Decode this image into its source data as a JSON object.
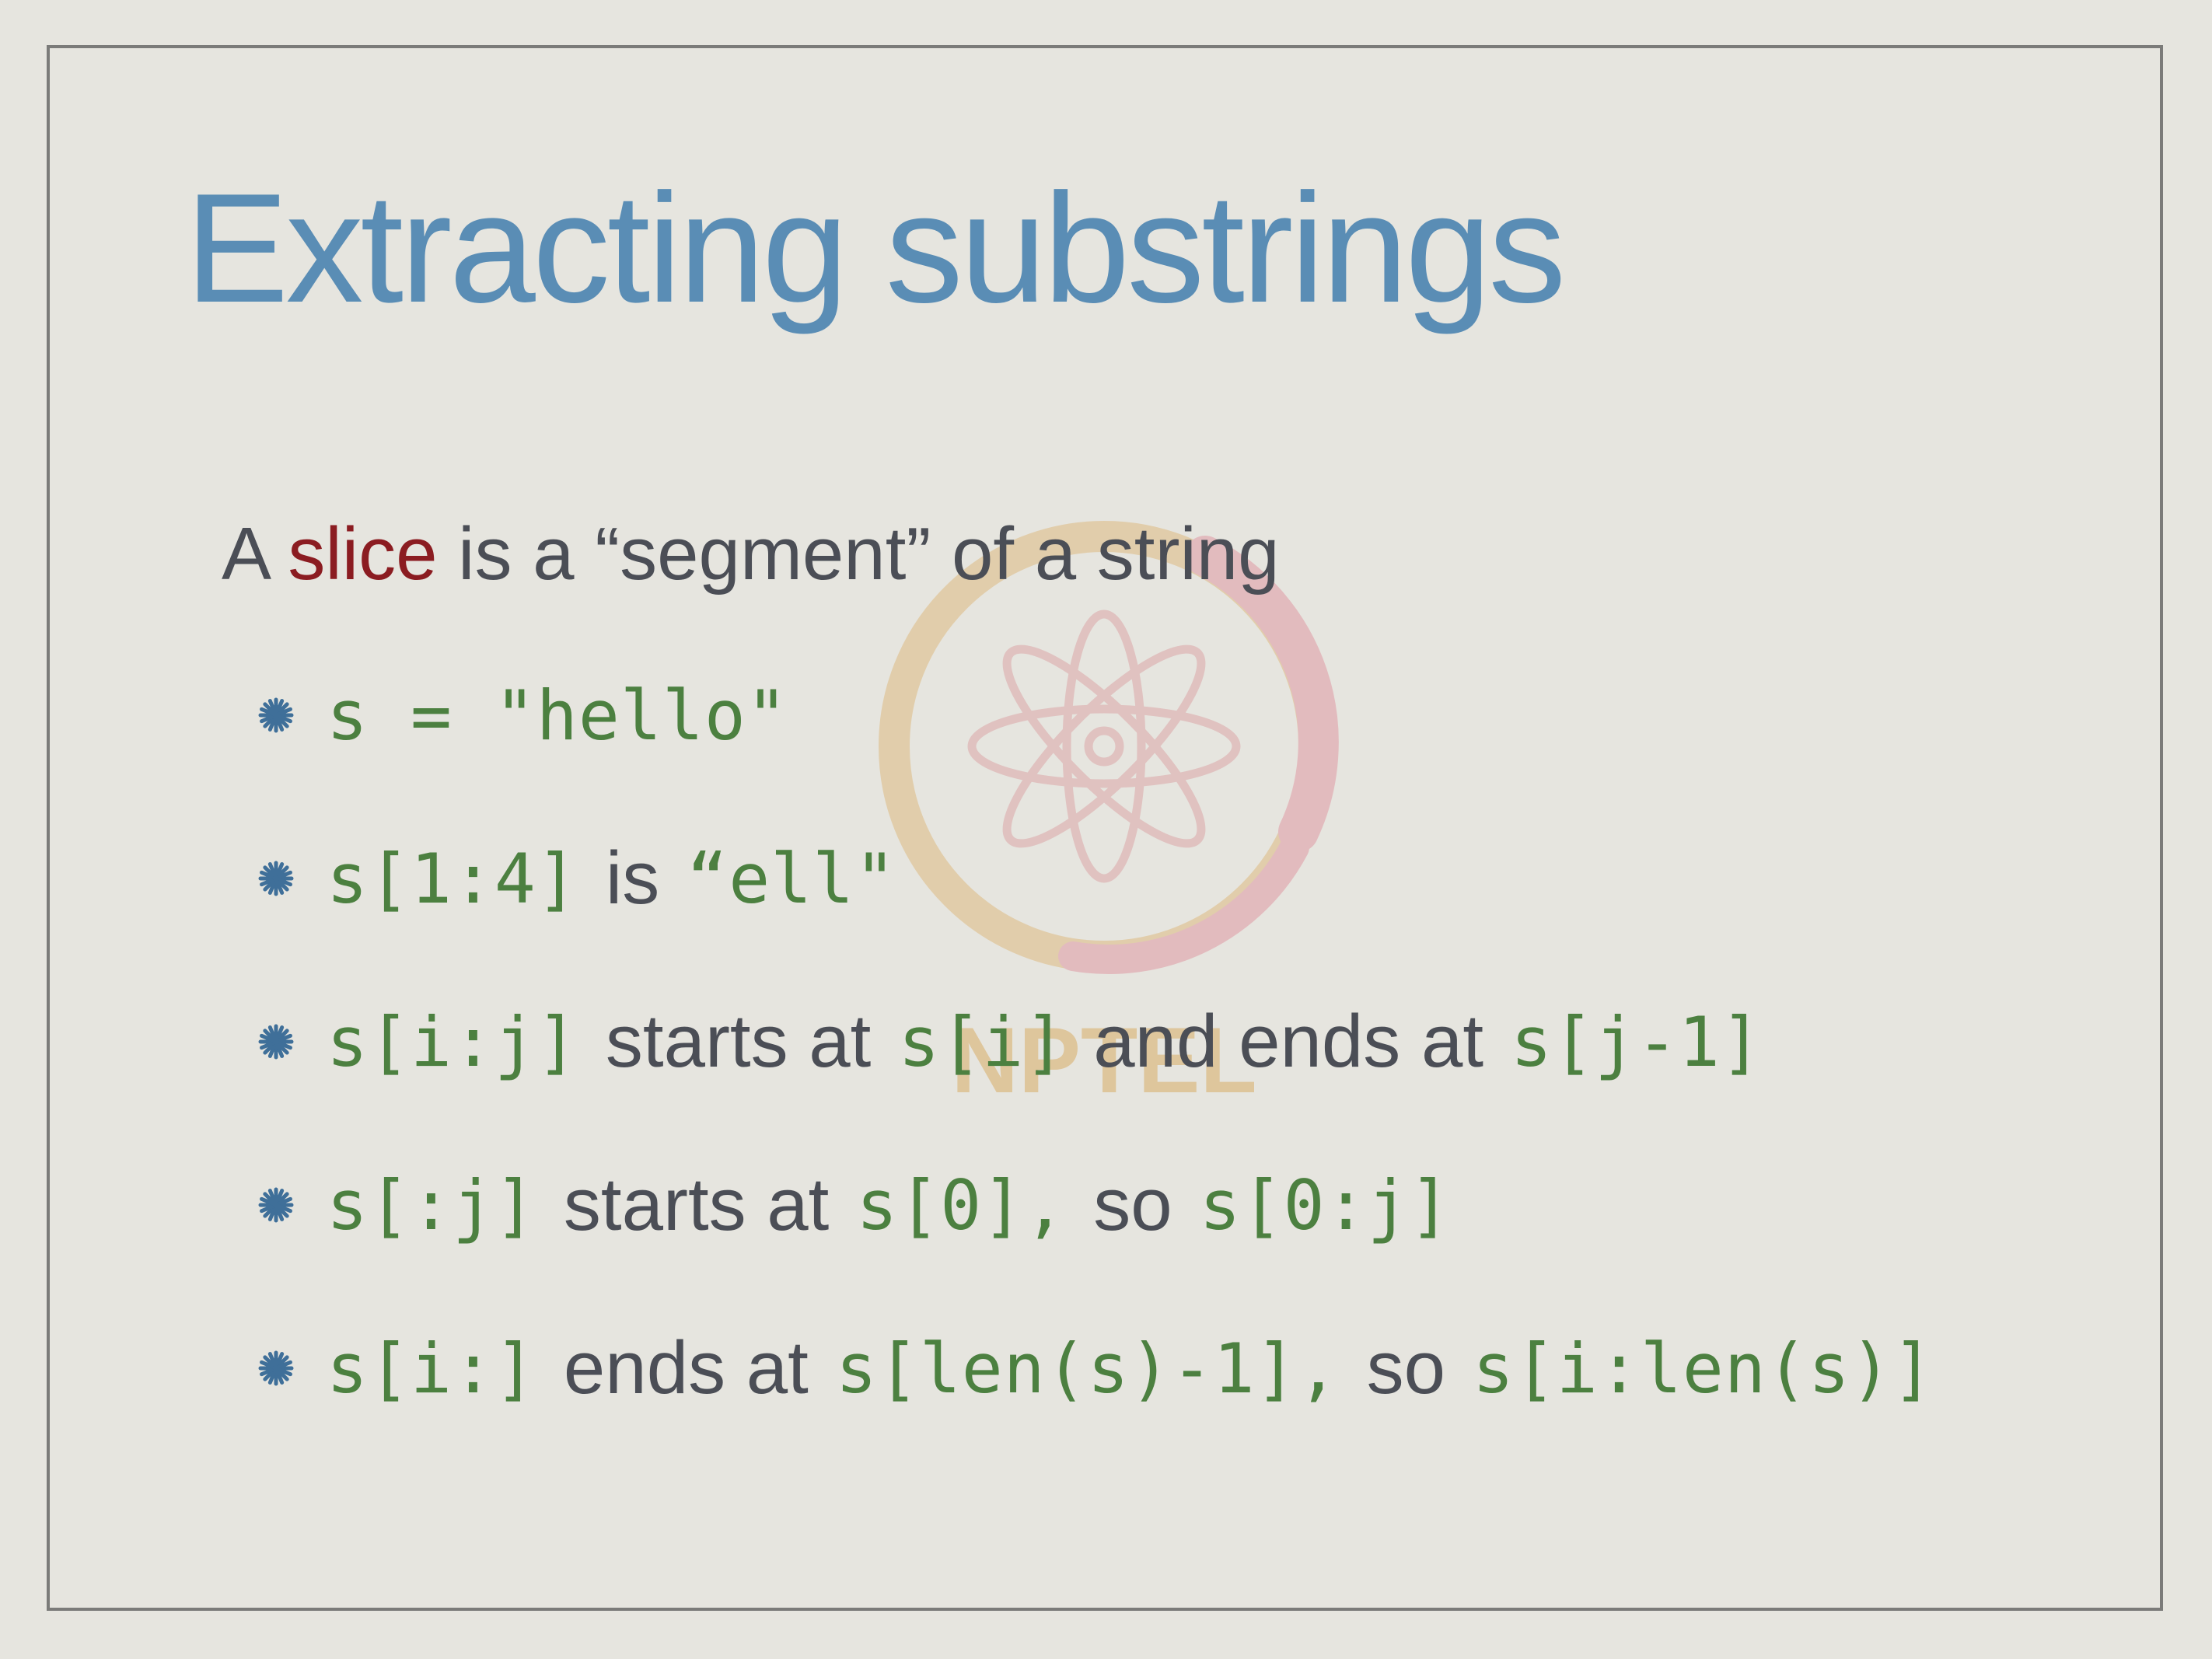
{
  "slide": {
    "title": "Extracting substrings",
    "intro": {
      "before": "A ",
      "highlight": "slice",
      "after": " is a “segment” of a string"
    },
    "bullets": [
      {
        "parts": [
          {
            "type": "code",
            "text": "s = \"hello\""
          }
        ]
      },
      {
        "parts": [
          {
            "type": "code",
            "text": "s[1:4]"
          },
          {
            "type": "text",
            "text": "is"
          },
          {
            "type": "code",
            "text": "“ell\""
          }
        ]
      },
      {
        "parts": [
          {
            "type": "code",
            "text": "s[i:j]"
          },
          {
            "type": "text",
            "text": "starts at"
          },
          {
            "type": "code",
            "text": "s[i]"
          },
          {
            "type": "text",
            "text": "and ends at"
          },
          {
            "type": "code",
            "text": "s[j-1]"
          }
        ]
      },
      {
        "parts": [
          {
            "type": "code",
            "text": "s[:j]"
          },
          {
            "type": "text",
            "text": "starts at"
          },
          {
            "type": "code",
            "text": "s[0],"
          },
          {
            "type": "text",
            "text": "so"
          },
          {
            "type": "code",
            "text": "s[0:j]"
          }
        ]
      },
      {
        "parts": [
          {
            "type": "code",
            "text": "s[i:]"
          },
          {
            "type": "text",
            "text": "ends at"
          },
          {
            "type": "code",
            "text": "s[len(s)-1],"
          },
          {
            "type": "text",
            "text": "so"
          },
          {
            "type": "code",
            "text": "s[i:len(s)]"
          }
        ]
      }
    ],
    "watermark": {
      "label": "NPTEL"
    },
    "icons": {
      "bullet": "asterisk-bullet-icon"
    },
    "colors": {
      "title": "#5a8db5",
      "body_text": "#4b4e56",
      "highlight": "#8b1c21",
      "code": "#4c8040",
      "bullet": "#3f6f99"
    }
  }
}
